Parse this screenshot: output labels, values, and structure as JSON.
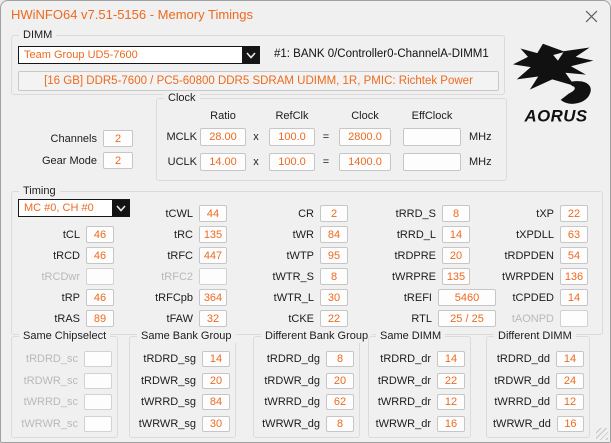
{
  "theme": {
    "accent": "#ee6a1e",
    "disabled_text": "#b9b9b9",
    "brand_color": "#111111"
  },
  "window": {
    "title": "HWiNFO64 v7.51-5156 - Memory Timings"
  },
  "brand": {
    "name": "AORUS"
  },
  "dimm": {
    "group_label": "DIMM",
    "selected_module": "Team Group UD5-7600",
    "slot": "#1: BANK 0/Controller0-ChannelA-DIMM1",
    "description": "[16 GB] DDR5-7600 / PC5-60800 DDR5 SDRAM UDIMM, 1R, PMIC: Richtek Power"
  },
  "general": {
    "channels_label": "Channels",
    "channels": "2",
    "gear_mode_label": "Gear Mode",
    "gear_mode": "2"
  },
  "clock": {
    "group_label": "Clock",
    "headers": {
      "ratio": "Ratio",
      "refclk": "RefClk",
      "clock": "Clock",
      "effclock": "EffClock"
    },
    "multiply_sign": "x",
    "equals_sign": "=",
    "unit": "MHz",
    "rows": [
      {
        "name": "MCLK",
        "ratio": "28.00",
        "refclk": "100.0",
        "clock": "2800.0",
        "effclock": ""
      },
      {
        "name": "UCLK",
        "ratio": "14.00",
        "refclk": "100.0",
        "clock": "1400.0",
        "effclock": ""
      }
    ]
  },
  "timing": {
    "group_label": "Timing",
    "selector": "MC #0, CH #0",
    "cols": [
      {
        "rows": [
          {
            "l": "tCL",
            "v": "46"
          },
          {
            "l": "tRCD",
            "v": "46"
          },
          {
            "l": "tRCDwr",
            "v": ""
          },
          {
            "l": "tRP",
            "v": "46"
          },
          {
            "l": "tRAS",
            "v": "89"
          }
        ]
      },
      {
        "rows": [
          {
            "l": "tCWL",
            "v": "44"
          },
          {
            "l": "tRC",
            "v": "135"
          },
          {
            "l": "tRFC",
            "v": "447"
          },
          {
            "l": "tRFC2",
            "v": ""
          },
          {
            "l": "tRFCpb",
            "v": "364"
          },
          {
            "l": "tFAW",
            "v": "32"
          }
        ]
      },
      {
        "rows": [
          {
            "l": "CR",
            "v": "2"
          },
          {
            "l": "tWR",
            "v": "84"
          },
          {
            "l": "tWTP",
            "v": "95"
          },
          {
            "l": "tWTR_S",
            "v": "8"
          },
          {
            "l": "tWTR_L",
            "v": "30"
          },
          {
            "l": "tCKE",
            "v": "22"
          }
        ]
      },
      {
        "rows": [
          {
            "l": "tRRD_S",
            "v": "8"
          },
          {
            "l": "tRRD_L",
            "v": "14"
          },
          {
            "l": "tRDPRE",
            "v": "20"
          },
          {
            "l": "tWRPRE",
            "v": "135"
          },
          {
            "l": "tREFI",
            "v": "5460"
          },
          {
            "l": "RTL",
            "v": "25 / 25"
          }
        ]
      },
      {
        "rows": [
          {
            "l": "tXP",
            "v": "22"
          },
          {
            "l": "tXPDLL",
            "v": "63"
          },
          {
            "l": "tRDPDEN",
            "v": "54"
          },
          {
            "l": "tWRPDEN",
            "v": "136"
          },
          {
            "l": "tCPDED",
            "v": "14"
          },
          {
            "l": "tAONPD",
            "v": ""
          }
        ]
      }
    ]
  },
  "groups": [
    {
      "title": "Same Chipselect",
      "rows": [
        {
          "l": "tRDRD_sc",
          "v": ""
        },
        {
          "l": "tRDWR_sc",
          "v": ""
        },
        {
          "l": "tWRRD_sc",
          "v": ""
        },
        {
          "l": "tWRWR_sc",
          "v": ""
        }
      ]
    },
    {
      "title": "Same Bank Group",
      "rows": [
        {
          "l": "tRDRD_sg",
          "v": "14"
        },
        {
          "l": "tRDWR_sg",
          "v": "20"
        },
        {
          "l": "tWRRD_sg",
          "v": "84"
        },
        {
          "l": "tWRWR_sg",
          "v": "30"
        }
      ]
    },
    {
      "title": "Different Bank Group",
      "rows": [
        {
          "l": "tRDRD_dg",
          "v": "8"
        },
        {
          "l": "tRDWR_dg",
          "v": "20"
        },
        {
          "l": "tWRRD_dg",
          "v": "62"
        },
        {
          "l": "tWRWR_dg",
          "v": "8"
        }
      ]
    },
    {
      "title": "Same DIMM",
      "rows": [
        {
          "l": "tRDRD_dr",
          "v": "14"
        },
        {
          "l": "tRDWR_dr",
          "v": "22"
        },
        {
          "l": "tWRRD_dr",
          "v": "12"
        },
        {
          "l": "tWRWR_dr",
          "v": "16"
        }
      ]
    },
    {
      "title": "Different DIMM",
      "rows": [
        {
          "l": "tRDRD_dd",
          "v": "14"
        },
        {
          "l": "tRDWR_dd",
          "v": "24"
        },
        {
          "l": "tWRRD_dd",
          "v": "12"
        },
        {
          "l": "tWRWR_dd",
          "v": "16"
        }
      ]
    }
  ]
}
